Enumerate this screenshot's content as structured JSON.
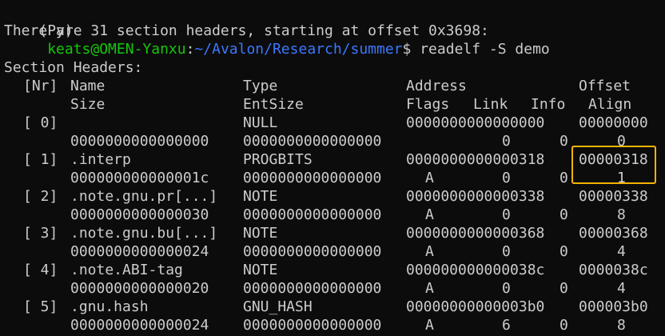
{
  "prompt": {
    "env": "(Py)",
    "user_host": "keats@OMEN-Yanxu",
    "sep": ":",
    "path": "~/Avalon/Research/summer",
    "symbol": "$",
    "command": "readelf -S demo"
  },
  "summary": "There are 31 section headers, starting at offset 0x3698:",
  "section_heading": "Section Headers:",
  "headers": {
    "row1": [
      "[Nr]",
      "Name",
      "Type",
      "Address",
      "Offset"
    ],
    "row2": [
      "Size",
      "EntSize",
      "Flags",
      "Link",
      "Info",
      "Align"
    ]
  },
  "sections": [
    {
      "nr": "[ 0]",
      "name": "",
      "type": "NULL",
      "address": "0000000000000000",
      "offset": "00000000",
      "size": "0000000000000000",
      "entsize": "0000000000000000",
      "flags": "",
      "link": "0",
      "info": "0",
      "align": "0"
    },
    {
      "nr": "[ 1]",
      "name": ".interp",
      "type": "PROGBITS",
      "address": "0000000000000318",
      "offset": "00000318",
      "size": "000000000000001c",
      "entsize": "0000000000000000",
      "flags": "A",
      "link": "0",
      "info": "0",
      "align": "1"
    },
    {
      "nr": "[ 2]",
      "name": ".note.gnu.pr[...]",
      "type": "NOTE",
      "address": "0000000000000338",
      "offset": "00000338",
      "size": "0000000000000030",
      "entsize": "0000000000000000",
      "flags": "A",
      "link": "0",
      "info": "0",
      "align": "8"
    },
    {
      "nr": "[ 3]",
      "name": ".note.gnu.bu[...]",
      "type": "NOTE",
      "address": "0000000000000368",
      "offset": "00000368",
      "size": "0000000000000024",
      "entsize": "0000000000000000",
      "flags": "A",
      "link": "0",
      "info": "0",
      "align": "4"
    },
    {
      "nr": "[ 4]",
      "name": ".note.ABI-tag",
      "type": "NOTE",
      "address": "000000000000038c",
      "offset": "0000038c",
      "size": "0000000000000020",
      "entsize": "0000000000000000",
      "flags": "A",
      "link": "0",
      "info": "0",
      "align": "4"
    },
    {
      "nr": "[ 5]",
      "name": ".gnu.hash",
      "type": "GNU_HASH",
      "address": "00000000000003b0",
      "offset": "000003b0",
      "size": "0000000000000024",
      "entsize": "0000000000000000",
      "flags": "A",
      "link": "6",
      "info": "0",
      "align": "8"
    }
  ],
  "colors": {
    "background": "#0c0c0c",
    "foreground": "#cccccc",
    "prompt_user": "#16c60c",
    "prompt_path": "#3b78ff",
    "highlight_box": "#f5b301"
  }
}
